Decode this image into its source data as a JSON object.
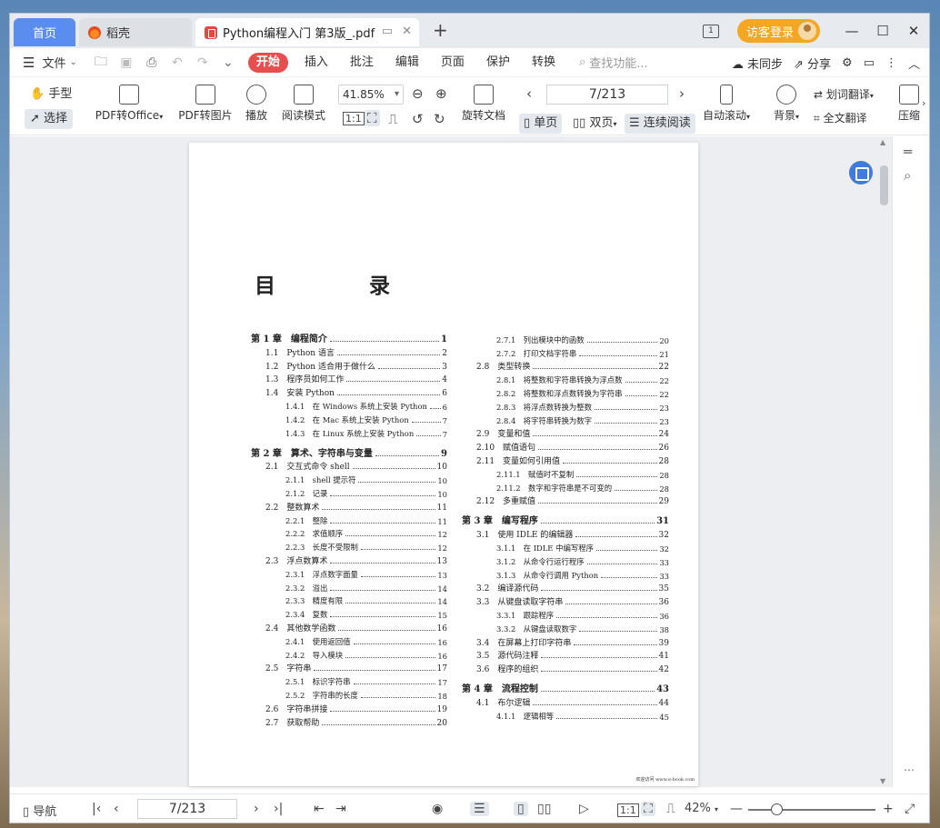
{
  "tabs": {
    "home": "首页",
    "daoke": "稻壳",
    "document": "Python编程入门 第3版_.pdf",
    "new_tab": "+"
  },
  "titlebar": {
    "reader_mode": "1",
    "login": "访客登录"
  },
  "menu": {
    "file": "文件",
    "tabs": [
      "开始",
      "插入",
      "批注",
      "编辑",
      "页面",
      "保护",
      "转换"
    ],
    "search": "查找功能...",
    "sync": "未同步",
    "share": "分享"
  },
  "toolbar": {
    "hand": "手型",
    "select": "选择",
    "pdf_to_office": "PDF转Office",
    "pdf_to_image": "PDF转图片",
    "play": "播放",
    "read_mode": "阅读模式",
    "zoom": "41.85%",
    "page_indicator": "7/213",
    "rotate": "旋转文档",
    "single_page": "单页",
    "double_page": "双页",
    "continuous": "连续阅读",
    "auto_scroll": "自动滚动",
    "background": "背景",
    "word_translate": "划词翻译",
    "full_translate": "全文翻译",
    "compress": "压缩"
  },
  "document": {
    "toc_title": "目　录",
    "col1": [
      {
        "level": "ch",
        "text": "第 1 章　编程简介",
        "page": "1"
      },
      {
        "level": "l1",
        "text": "1.1　Python 语言",
        "page": "2"
      },
      {
        "level": "l1",
        "text": "1.2　Python 适合用于做什么",
        "page": "3"
      },
      {
        "level": "l1",
        "text": "1.3　程序员如何工作",
        "page": "4"
      },
      {
        "level": "l1",
        "text": "1.4　安装 Python",
        "page": "6"
      },
      {
        "level": "l2",
        "text": "1.4.1　在 Windows 系统上安装 Python",
        "page": "6"
      },
      {
        "level": "l2",
        "text": "1.4.2　在 Mac 系统上安装 Python",
        "page": "7"
      },
      {
        "level": "l2",
        "text": "1.4.3　在 Linux 系统上安装 Python",
        "page": "7"
      },
      {
        "level": "ch",
        "text": "第 2 章　算术、字符串与变量",
        "page": "9"
      },
      {
        "level": "l1",
        "text": "2.1　交互式命令 shell",
        "page": "10"
      },
      {
        "level": "l2",
        "text": "2.1.1　shell 提示符",
        "page": "10"
      },
      {
        "level": "l2",
        "text": "2.1.2　记录",
        "page": "10"
      },
      {
        "level": "l1",
        "text": "2.2　整数算术",
        "page": "11"
      },
      {
        "level": "l2",
        "text": "2.2.1　整除",
        "page": "11"
      },
      {
        "level": "l2",
        "text": "2.2.2　求值顺序",
        "page": "12"
      },
      {
        "level": "l2",
        "text": "2.2.3　长度不受限制",
        "page": "12"
      },
      {
        "level": "l1",
        "text": "2.3　浮点数算术",
        "page": "13"
      },
      {
        "level": "l2",
        "text": "2.3.1　浮点数字面量",
        "page": "13"
      },
      {
        "level": "l2",
        "text": "2.3.2　溢出",
        "page": "14"
      },
      {
        "level": "l2",
        "text": "2.3.3　精度有限",
        "page": "14"
      },
      {
        "level": "l2",
        "text": "2.3.4　复数",
        "page": "15"
      },
      {
        "level": "l1",
        "text": "2.4　其他数学函数",
        "page": "16"
      },
      {
        "level": "l2",
        "text": "2.4.1　使用返回值",
        "page": "16"
      },
      {
        "level": "l2",
        "text": "2.4.2　导入模块",
        "page": "16"
      },
      {
        "level": "l1",
        "text": "2.5　字符串",
        "page": "17"
      },
      {
        "level": "l2",
        "text": "2.5.1　标识字符串",
        "page": "17"
      },
      {
        "level": "l2",
        "text": "2.5.2　字符串的长度",
        "page": "18"
      },
      {
        "level": "l1",
        "text": "2.6　字符串拼接",
        "page": "19"
      },
      {
        "level": "l1",
        "text": "2.7　获取帮助",
        "page": "20"
      }
    ],
    "col2": [
      {
        "level": "l2",
        "text": "2.7.1　列出模块中的函数",
        "page": "20"
      },
      {
        "level": "l2",
        "text": "2.7.2　打印文档字符串",
        "page": "21"
      },
      {
        "level": "l1",
        "text": "2.8　类型转换",
        "page": "22"
      },
      {
        "level": "l2",
        "text": "2.8.1　将整数和字符串转换为浮点数",
        "page": "22"
      },
      {
        "level": "l2",
        "text": "2.8.2　将整数和浮点数转换为字符串",
        "page": "22"
      },
      {
        "level": "l2",
        "text": "2.8.3　将浮点数转换为整数",
        "page": "23"
      },
      {
        "level": "l2",
        "text": "2.8.4　将字符串转换为数字",
        "page": "23"
      },
      {
        "level": "l1",
        "text": "2.9　变量和值",
        "page": "24"
      },
      {
        "level": "l1",
        "text": "2.10　赋值语句",
        "page": "26"
      },
      {
        "level": "l1",
        "text": "2.11　变量如何引用值",
        "page": "28"
      },
      {
        "level": "l2",
        "text": "2.11.1　赋值时不复制",
        "page": "28"
      },
      {
        "level": "l2",
        "text": "2.11.2　数字和字符串是不可变的",
        "page": "28"
      },
      {
        "level": "l1",
        "text": "2.12　多重赋值",
        "page": "29"
      },
      {
        "level": "ch",
        "text": "第 3 章　编写程序",
        "page": "31"
      },
      {
        "level": "l1",
        "text": "3.1　使用 IDLE 的编辑器",
        "page": "32"
      },
      {
        "level": "l2",
        "text": "3.1.1　在 IDLE 中编写程序",
        "page": "32"
      },
      {
        "level": "l2",
        "text": "3.1.2　从命令行运行程序",
        "page": "33"
      },
      {
        "level": "l2",
        "text": "3.1.3　从命令行调用 Python",
        "page": "33"
      },
      {
        "level": "l1",
        "text": "3.2　编译源代码",
        "page": "35"
      },
      {
        "level": "l1",
        "text": "3.3　从键盘读取字符串",
        "page": "36"
      },
      {
        "level": "l2",
        "text": "3.3.1　跟踪程序",
        "page": "36"
      },
      {
        "level": "l2",
        "text": "3.3.2　从键盘读取数字",
        "page": "38"
      },
      {
        "level": "l1",
        "text": "3.4　在屏幕上打印字符串",
        "page": "39"
      },
      {
        "level": "l1",
        "text": "3.5　源代码注释",
        "page": "41"
      },
      {
        "level": "l1",
        "text": "3.6　程序的组织",
        "page": "42"
      },
      {
        "level": "ch",
        "text": "第 4 章　流程控制",
        "page": "43"
      },
      {
        "level": "l1",
        "text": "4.1　布尔逻辑",
        "page": "44"
      },
      {
        "level": "l2",
        "text": "4.1.1　逻辑相等",
        "page": "45"
      }
    ],
    "footer": "欢迎访问 www.e-book.com"
  },
  "statusbar": {
    "nav": "导航",
    "page_indicator": "7/213",
    "zoom": "42%",
    "zoom_slider_level": 0.2
  }
}
